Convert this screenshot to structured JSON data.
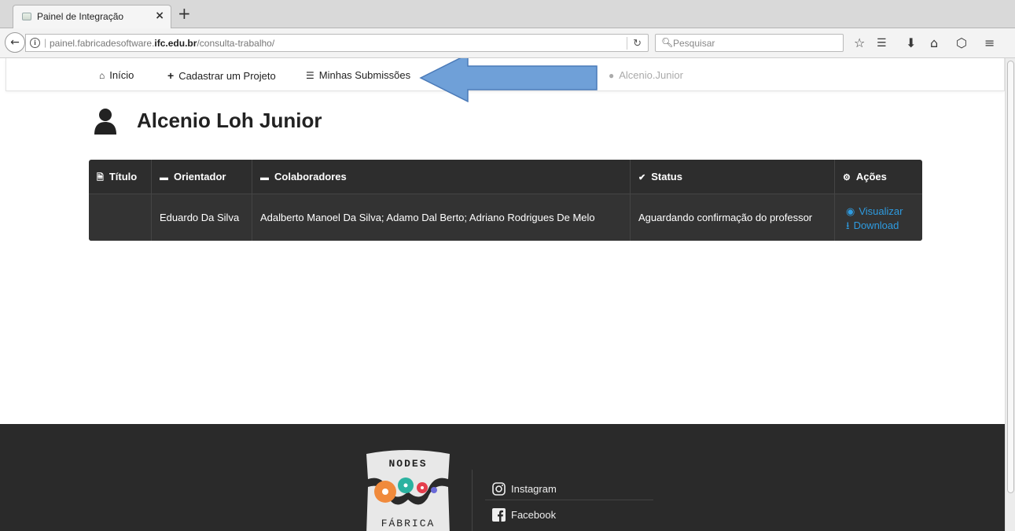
{
  "browser": {
    "tab_title": "Painel de Integração",
    "tab_close": "×",
    "new_tab": "+",
    "url_prefix": "painel.fabricadesoftware.",
    "url_domain": "ifc.edu.br",
    "url_path": "/consulta-trabalho/",
    "search_placeholder": "Pesquisar"
  },
  "nav": {
    "items": [
      {
        "label": "Início",
        "icon": "home-icon"
      },
      {
        "label": "Cadastrar um Projeto",
        "icon": "plus-icon"
      },
      {
        "label": "Minhas Submissões",
        "icon": "list-icon"
      }
    ],
    "user": "Alcenio.Junior"
  },
  "page": {
    "title": "Alcenio Loh Junior"
  },
  "table": {
    "headers": [
      {
        "label": "Título",
        "icon": "file-icon"
      },
      {
        "label": "Orientador",
        "icon": "comment-icon"
      },
      {
        "label": "Colaboradores",
        "icon": "comment-icon"
      },
      {
        "label": "Status",
        "icon": "check-icon"
      },
      {
        "label": "Ações",
        "icon": "gear-icon"
      }
    ],
    "rows": [
      {
        "titulo": "",
        "orientador": "Eduardo Da Silva",
        "colaboradores": "Adalberto Manoel Da Silva; Adamo Dal Berto; Adriano Rodrigues De Melo",
        "status": "Aguardando confirmação do professor",
        "actions": [
          "Visualizar",
          "Download"
        ]
      }
    ]
  },
  "footer": {
    "social": [
      "Instagram",
      "Facebook"
    ]
  },
  "colors": {
    "table_bg": "#2d2d2d",
    "footer_bg": "#2a2a2a",
    "link": "#2e9be0",
    "annotation_arrow": "#6fa0d8"
  }
}
